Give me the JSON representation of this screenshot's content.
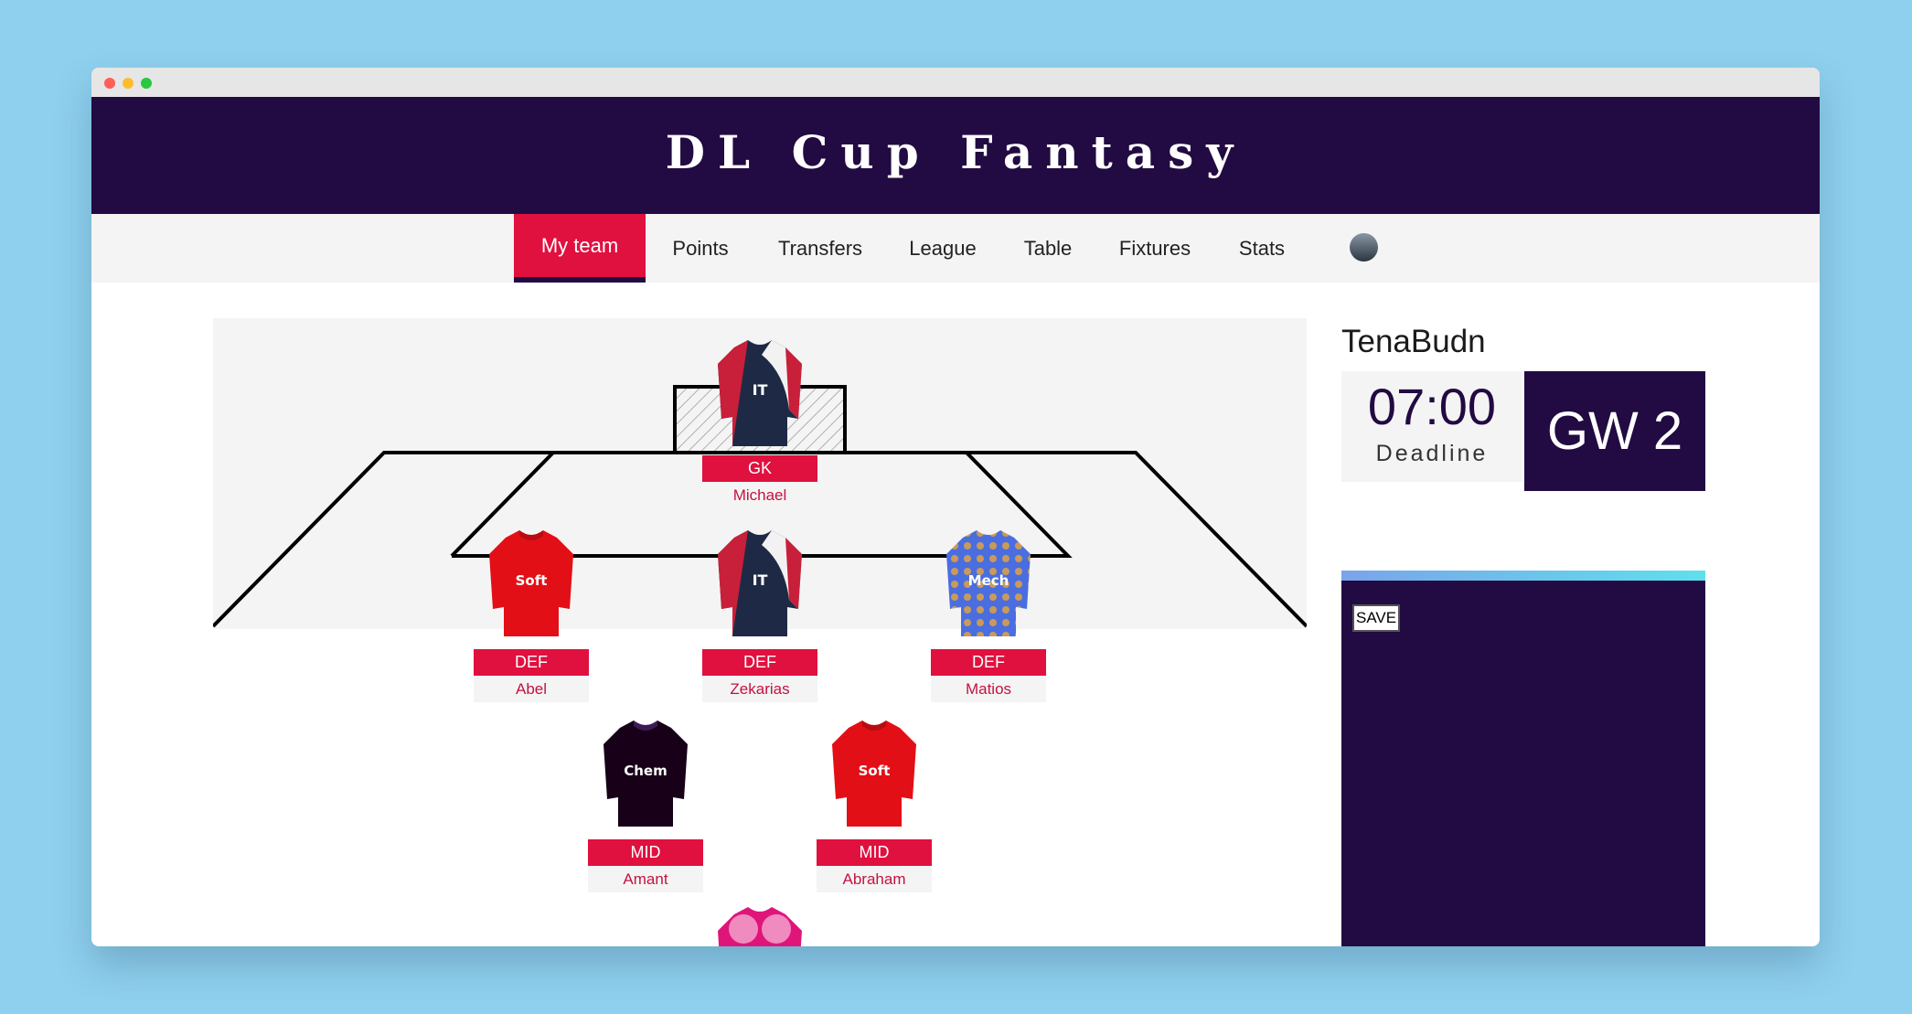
{
  "app": {
    "title": "DL Cup Fantasy"
  },
  "nav": {
    "items": [
      {
        "label": "My team",
        "active": true
      },
      {
        "label": "Points"
      },
      {
        "label": "Transfers"
      },
      {
        "label": "League"
      },
      {
        "label": "Table"
      },
      {
        "label": "Fixtures"
      },
      {
        "label": "Stats"
      }
    ]
  },
  "team": {
    "name": "TenaBudn",
    "deadline_time": "07:00",
    "deadline_label": "Deadline",
    "gameweek": "GW 2",
    "save_label": "SAVE"
  },
  "players": [
    {
      "position": "GK",
      "name": "Michael",
      "shirt_text": "IT",
      "shirt_style": "it"
    },
    {
      "position": "DEF",
      "name": "Abel",
      "shirt_text": "Soft",
      "shirt_style": "soft"
    },
    {
      "position": "DEF",
      "name": "Zekarias",
      "shirt_text": "IT",
      "shirt_style": "it"
    },
    {
      "position": "DEF",
      "name": "Matios",
      "shirt_text": "Mech",
      "shirt_style": "mech"
    },
    {
      "position": "MID",
      "name": "Amant",
      "shirt_text": "Chem",
      "shirt_style": "chem"
    },
    {
      "position": "MID",
      "name": "Abraham",
      "shirt_text": "Soft",
      "shirt_style": "soft"
    },
    {
      "position": "",
      "name": "",
      "shirt_text": "",
      "shirt_style": "pink"
    }
  ],
  "colors": {
    "brand_dark": "#220a42",
    "accent_red": "#e0103f",
    "background": "#8fd0ee"
  }
}
